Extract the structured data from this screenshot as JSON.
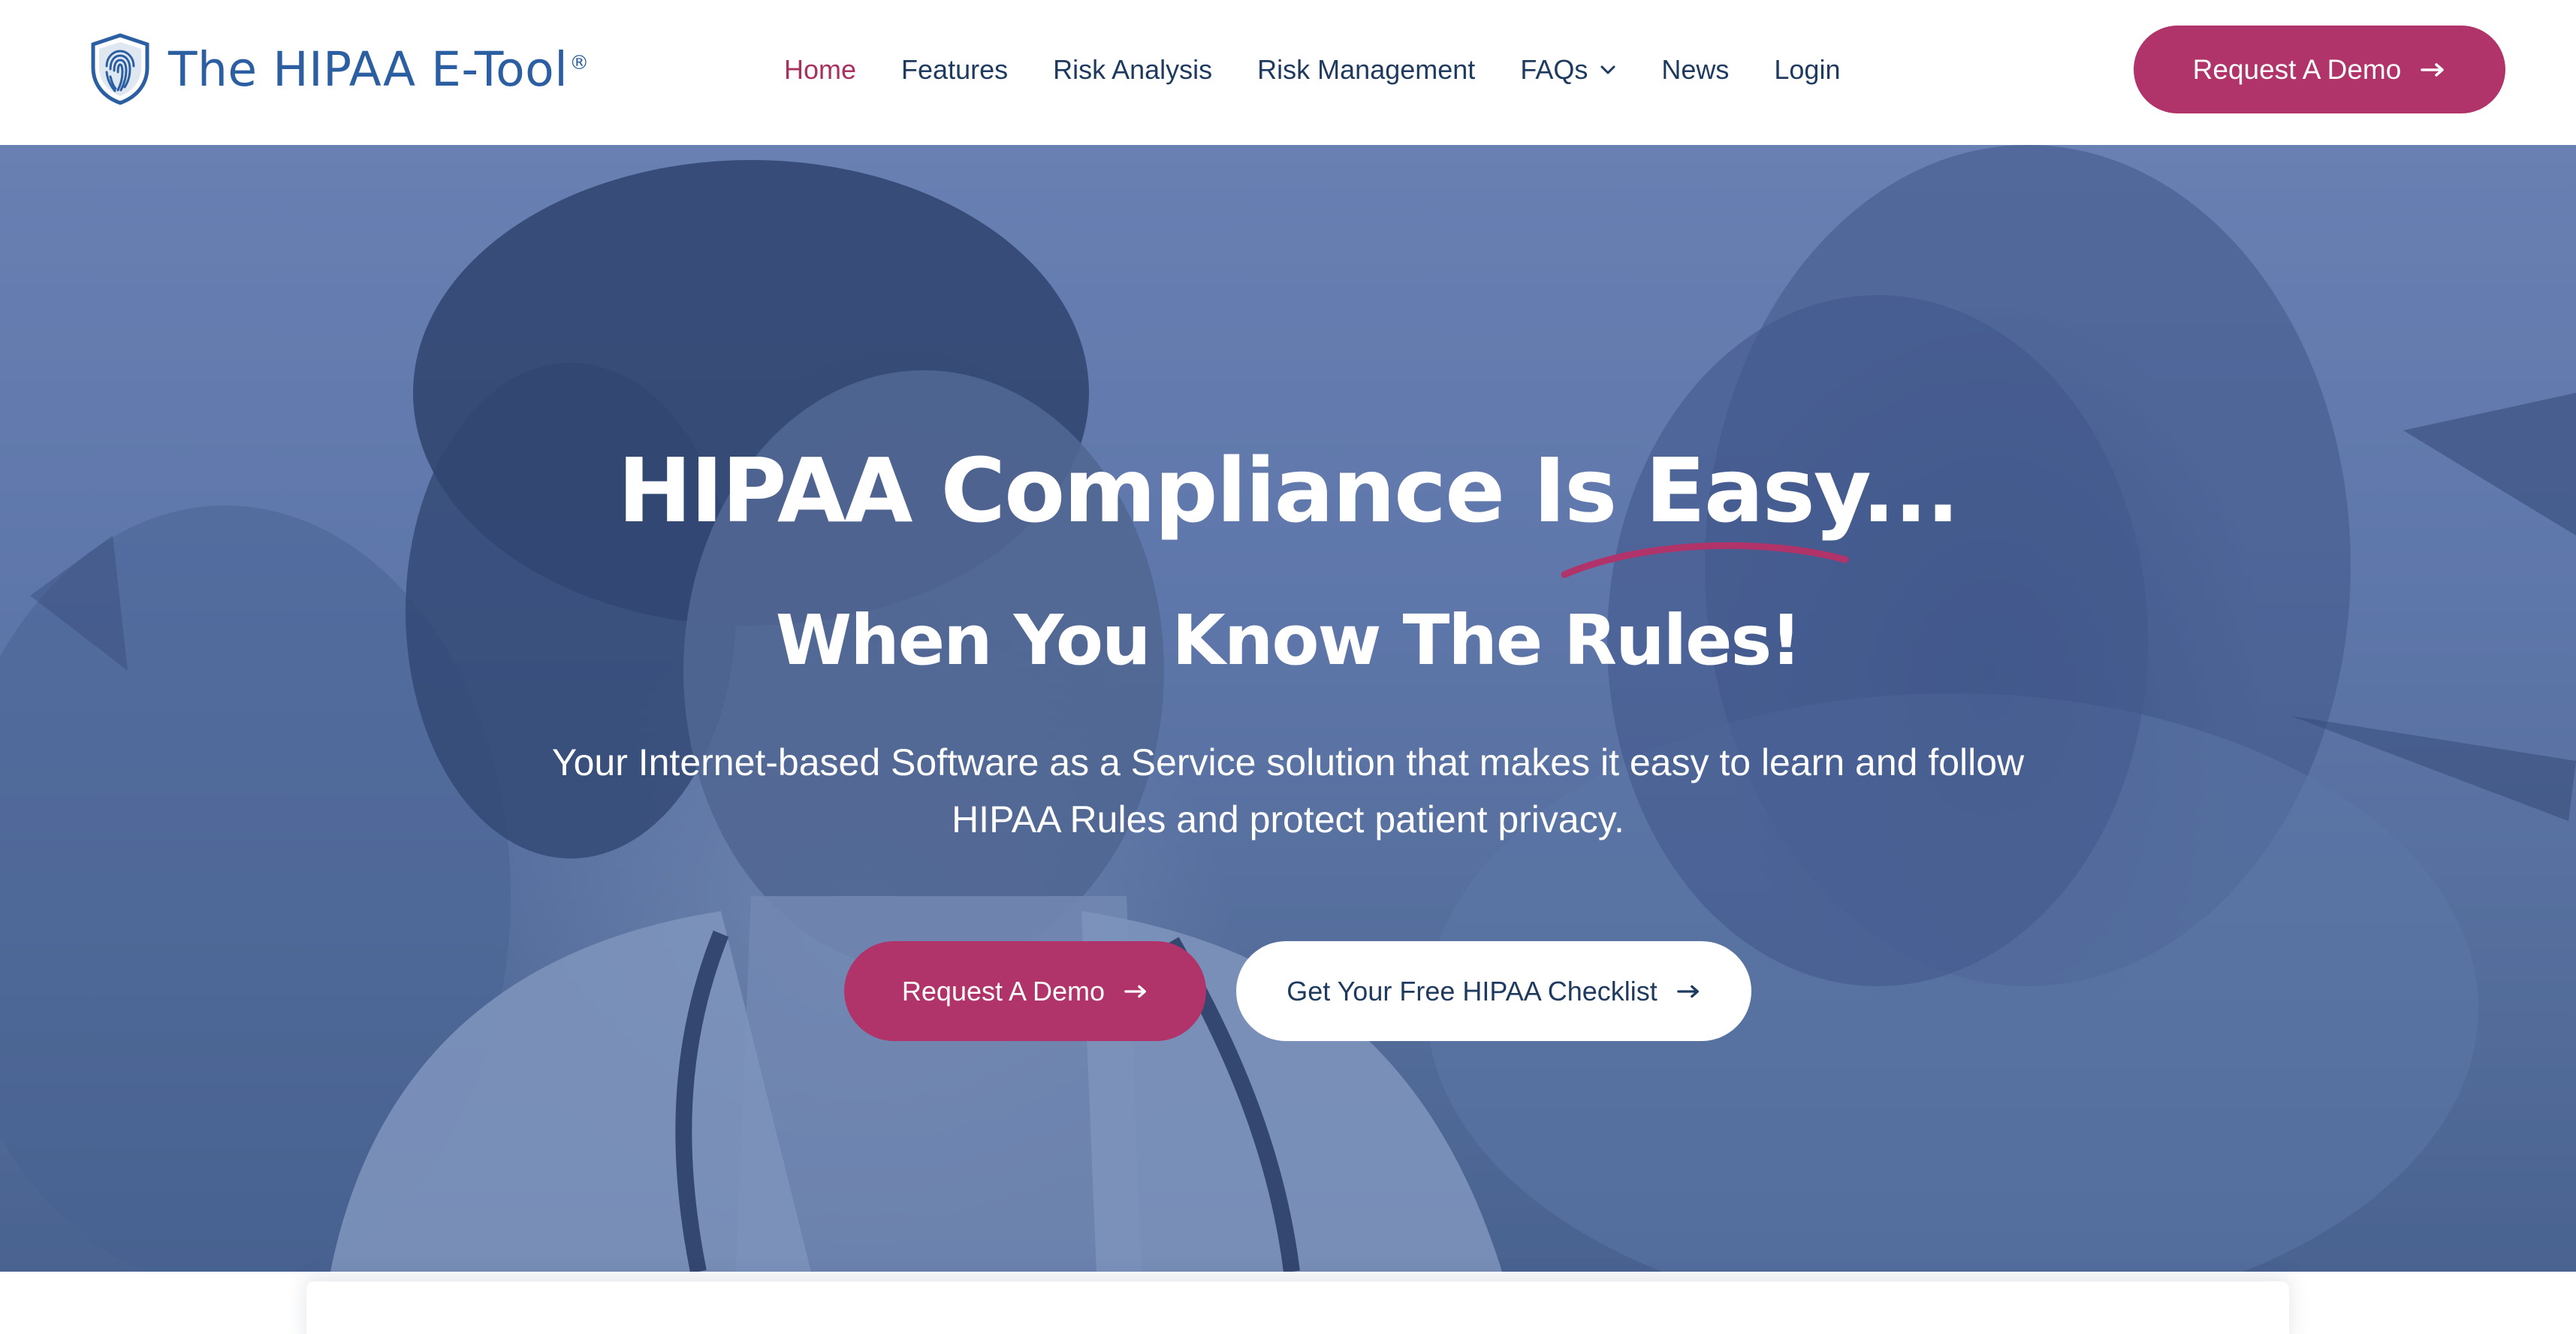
{
  "header": {
    "logo_text": "The HIPAA E-Tool",
    "logo_registered": "®",
    "logo_icon": "fingerprint-shield-icon",
    "nav": [
      {
        "label": "Home",
        "active": true
      },
      {
        "label": "Features"
      },
      {
        "label": "Risk Analysis"
      },
      {
        "label": "Risk Management"
      },
      {
        "label": "FAQs",
        "has_dropdown": true
      },
      {
        "label": "News"
      },
      {
        "label": "Login"
      }
    ],
    "demo_button": "Request A Demo"
  },
  "hero": {
    "title": "HIPAA Compliance Is Easy...",
    "subtitle": "When You Know The Rules!",
    "description": "Your Internet-based Software as a Service solution that makes it easy to learn and follow HIPAA Rules and protect patient privacy.",
    "primary_button": "Request A Demo",
    "secondary_button": "Get Your Free HIPAA Checklist"
  },
  "colors": {
    "brand_blue": "#2b5fa2",
    "nav_text": "#1f3a5f",
    "accent": "#b0336a",
    "hero_overlay": "#5f789f"
  }
}
